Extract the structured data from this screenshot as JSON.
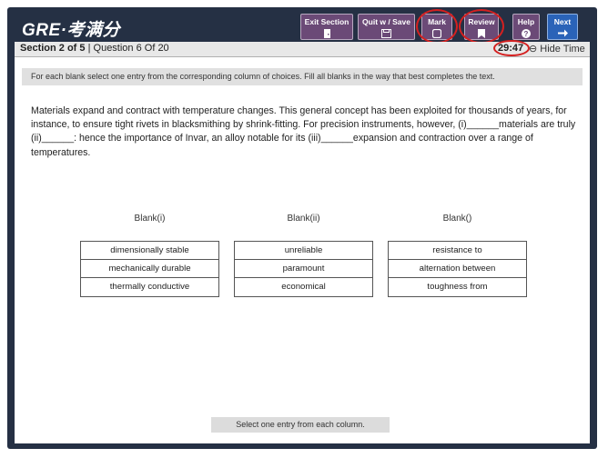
{
  "header": {
    "logo": "GRE·考满分",
    "buttons": {
      "exit_section": "Exit Section",
      "quit_save": "Quit w / Save",
      "mark": "Mark",
      "review": "Review",
      "help": "Help",
      "next": "Next"
    }
  },
  "status": {
    "section": "Section 2 of 5",
    "separator": " | ",
    "question": "Question 6 Of 20",
    "timer": "29:47",
    "hide_time": "⊖ Hide Time"
  },
  "instructions": "For each blank select one entry from the corresponding column of choices. Fill all blanks in the way that best completes the text.",
  "passage": "Materials expand and contract with temperature changes. This general concept has been exploited for thousands of years, for instance, to ensure tight rivets in blacksmithing by shrink-fitting. For precision instruments, however, (i)______materials are truly (ii)______: hence the importance of Invar, an alloy notable for its (iii)______expansion and contraction over a range of temperatures.",
  "columns": [
    {
      "heading": "Blank(i)",
      "options": [
        "dimensionally stable",
        "mechanically durable",
        "thermally conductive"
      ]
    },
    {
      "heading": "Blank(ii)",
      "options": [
        "unreliable",
        "paramount",
        "economical"
      ]
    },
    {
      "heading": "Blank()",
      "options": [
        "resistance to",
        "alternation between",
        "toughness from"
      ]
    }
  ],
  "footer_hint": "Select one entry from each column.",
  "colors": {
    "frame": "#253044",
    "purple_button": "#6b4a77",
    "next_button": "#2a63b8",
    "highlight_circle": "#d42020"
  }
}
